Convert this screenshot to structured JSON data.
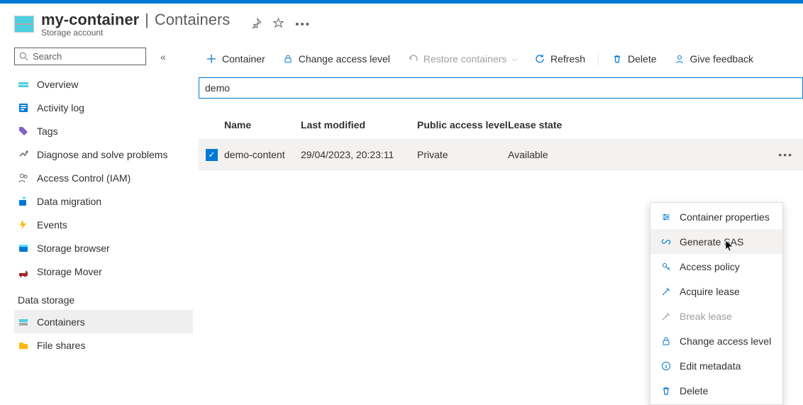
{
  "header": {
    "account": "my-container",
    "page": "Containers",
    "subtitle": "Storage account"
  },
  "sidebar": {
    "search_placeholder": "Search",
    "items": [
      {
        "label": "Overview",
        "icon": "overview"
      },
      {
        "label": "Activity log",
        "icon": "log"
      },
      {
        "label": "Tags",
        "icon": "tags"
      },
      {
        "label": "Diagnose and solve problems",
        "icon": "diag"
      },
      {
        "label": "Access Control (IAM)",
        "icon": "iam"
      },
      {
        "label": "Data migration",
        "icon": "migrate"
      },
      {
        "label": "Events",
        "icon": "events"
      },
      {
        "label": "Storage browser",
        "icon": "browser"
      },
      {
        "label": "Storage Mover",
        "icon": "mover"
      }
    ],
    "section": "Data storage",
    "storage_items": [
      {
        "label": "Containers",
        "icon": "container",
        "selected": true
      },
      {
        "label": "File shares",
        "icon": "files"
      }
    ]
  },
  "toolbar": {
    "container": "Container",
    "change_access": "Change access level",
    "restore": "Restore containers",
    "refresh": "Refresh",
    "delete": "Delete",
    "feedback": "Give feedback"
  },
  "filter": {
    "value": "demo"
  },
  "table": {
    "headers": {
      "name": "Name",
      "modified": "Last modified",
      "access": "Public access level",
      "lease": "Lease state"
    },
    "rows": [
      {
        "name": "demo-content",
        "modified": "29/04/2023, 20:23:11",
        "access": "Private",
        "lease": "Available",
        "checked": true
      }
    ]
  },
  "context_menu": [
    {
      "label": "Container properties",
      "icon": "props"
    },
    {
      "label": "Generate SAS",
      "icon": "link",
      "hovered": true
    },
    {
      "label": "Access policy",
      "icon": "key"
    },
    {
      "label": "Acquire lease",
      "icon": "lease"
    },
    {
      "label": "Break lease",
      "icon": "break",
      "disabled": true
    },
    {
      "label": "Change access level",
      "icon": "lock"
    },
    {
      "label": "Edit metadata",
      "icon": "info"
    },
    {
      "label": "Delete",
      "icon": "trash"
    }
  ]
}
